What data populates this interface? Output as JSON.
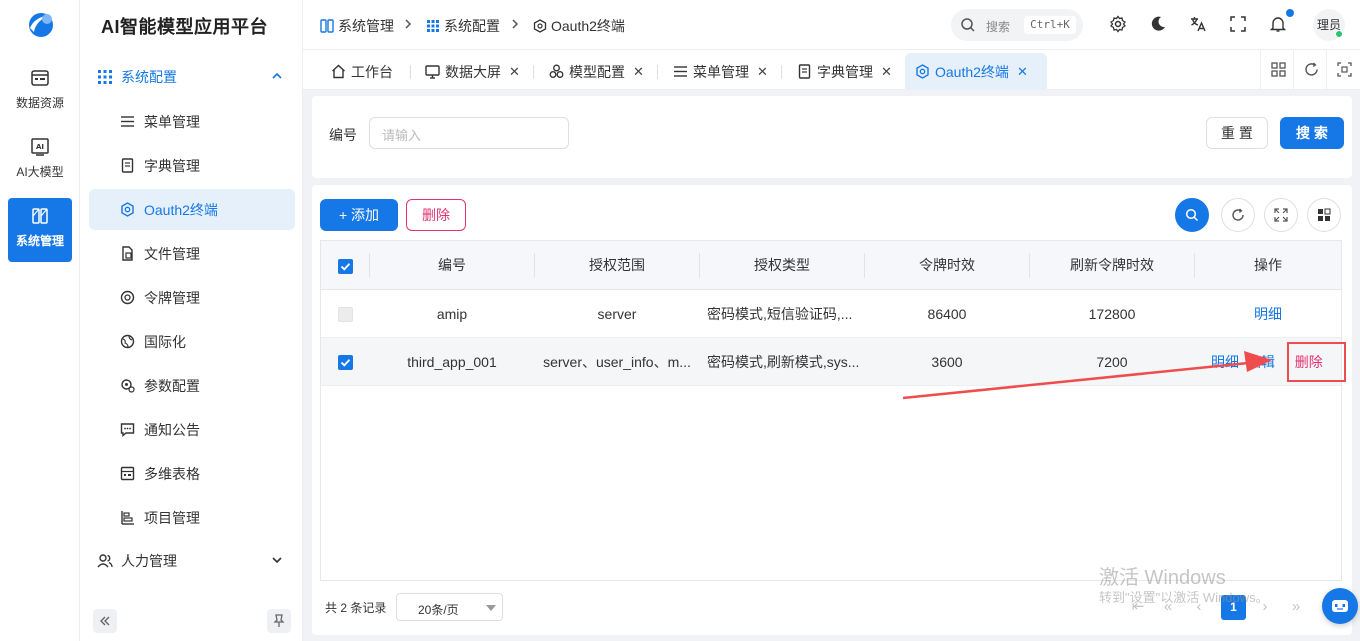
{
  "app": {
    "title": "AI智能模型应用平台"
  },
  "rail": [
    {
      "label": "数据资源",
      "icon": "database-icon"
    },
    {
      "label": "AI大模型",
      "icon": "ai-icon"
    },
    {
      "label": "系统管理",
      "icon": "system-icon"
    }
  ],
  "sidebar": {
    "group_system_config": "系统配置",
    "items": [
      {
        "label": "菜单管理",
        "icon": "list-icon"
      },
      {
        "label": "字典管理",
        "icon": "book-icon"
      },
      {
        "label": "Oauth2终端",
        "icon": "hexagon-icon"
      },
      {
        "label": "文件管理",
        "icon": "file-icon"
      },
      {
        "label": "令牌管理",
        "icon": "token-icon"
      },
      {
        "label": "国际化",
        "icon": "globe-icon"
      },
      {
        "label": "参数配置",
        "icon": "settings-gear-icon"
      },
      {
        "label": "通知公告",
        "icon": "message-icon"
      },
      {
        "label": "多维表格",
        "icon": "table-icon"
      },
      {
        "label": "项目管理",
        "icon": "project-icon"
      }
    ],
    "group_hr": "人力管理"
  },
  "breadcrumb": [
    "系统管理",
    "系统配置",
    "Oauth2终端"
  ],
  "header": {
    "search_placeholder": "搜索",
    "search_shortcut": "Ctrl+K",
    "user_name": "理员"
  },
  "tabs": [
    "工作台",
    "数据大屏",
    "模型配置",
    "菜单管理",
    "字典管理",
    "Oauth2终端"
  ],
  "search_form": {
    "field_label": "编号",
    "field_placeholder": "请输入",
    "reset_label": "重 置",
    "search_label": "搜 索"
  },
  "toolbar": {
    "add_label": "+ 添加",
    "delete_label": "删除"
  },
  "table": {
    "columns": [
      "编号",
      "授权范围",
      "授权类型",
      "令牌时效",
      "刷新令牌时效",
      "操作"
    ],
    "rows": [
      {
        "id": "amip",
        "scope": "server",
        "grant_types": "密码模式,短信验证码,...",
        "token_ttl": "86400",
        "refresh_ttl": "172800",
        "actions": [
          "明细"
        ]
      },
      {
        "id": "third_app_001",
        "scope": "server、user_info、m...",
        "grant_types": "密码模式,刷新模式,sys...",
        "token_ttl": "3600",
        "refresh_ttl": "7200",
        "actions": [
          "明细",
          "编辑",
          "删除"
        ]
      }
    ]
  },
  "pagination": {
    "total_text": "共 2 条记录",
    "page_size": "20条/页",
    "current_page": "1"
  },
  "watermark": {
    "line1": "激活 Windows",
    "line2": "转到\"设置\"以激活 Windows。"
  },
  "colors": {
    "primary": "#1677e6",
    "danger": "#e3336d",
    "annotation": "#ef4d4d"
  }
}
